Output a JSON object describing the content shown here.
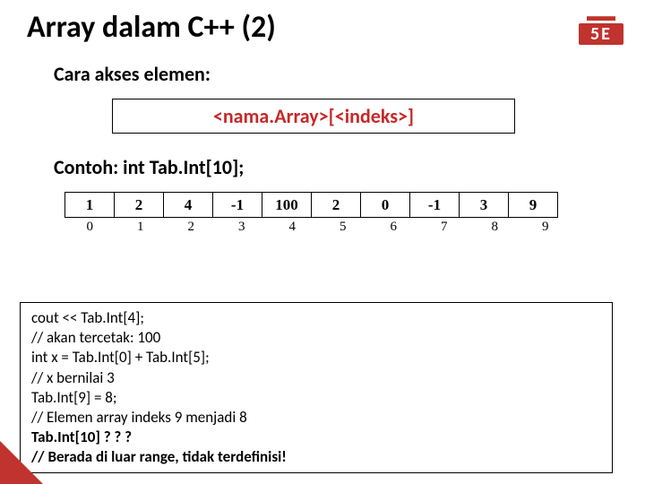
{
  "title": "Array dalam C++ (2)",
  "subheading": "Cara akses elemen:",
  "syntax": {
    "full": "<nama.Array>[<indeks>]"
  },
  "example_heading": "Contoh:  int Tab.Int[10];",
  "array_values": [
    "1",
    "2",
    "4",
    "-1",
    "100",
    "2",
    "0",
    "-1",
    "3",
    "9"
  ],
  "array_indices": [
    "0",
    "1",
    "2",
    "3",
    "4",
    "5",
    "6",
    "7",
    "8",
    "9"
  ],
  "code": {
    "l1": "cout << Tab.Int[4];",
    "l2": "// akan tercetak: 100",
    "l3": "int x = Tab.Int[0] + Tab.Int[5];",
    "l4": "// x bernilai 3",
    "l5": "Tab.Int[9] = 8;",
    "l6": "// Elemen array indeks 9 menjadi 8",
    "l7": "Tab.Int[10] ? ? ?",
    "l8": "// Berada di luar range, tidak terdefinisi!"
  },
  "logo": {
    "top": "▬▬",
    "mid": "5E"
  }
}
